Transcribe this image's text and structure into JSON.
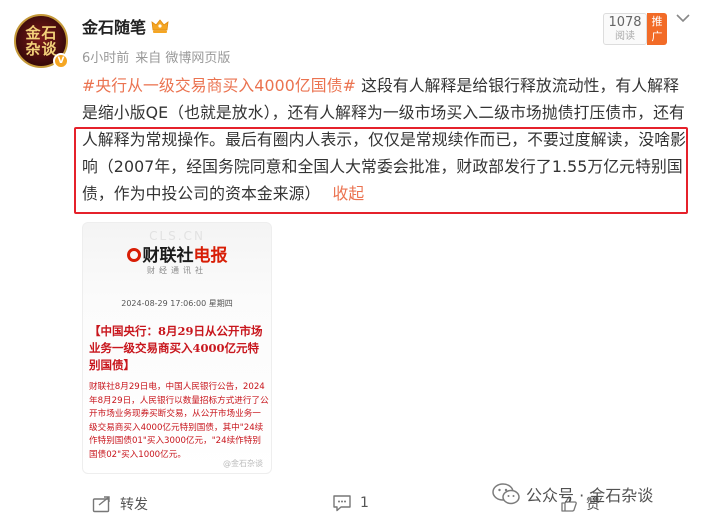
{
  "author": {
    "name": "金石随笔",
    "avatar_chars": [
      "金",
      "石",
      "杂",
      "谈"
    ]
  },
  "meta": {
    "time": "6小时前",
    "source": "来自 微博网页版"
  },
  "read": {
    "count": "1078",
    "label": "阅读",
    "promote": "推广"
  },
  "post": {
    "topic": "#央行从一级交易商买入4000亿国债#",
    "body": "这段有人解释是给银行释放流动性，有人解释是缩小版QE（也就是放水），还有人解释为一级市场买入二级市场抛债打压债市，还有人解释为常规操作。最后有圈内人表示，仅仅是常规续作而已，不要过度解读，没啥影响（2007年，经国务院同意和全国人大常委会批准，财政部发行了1.55万亿元特别国债，作为中投公司的资本金来源）",
    "collapse": "收起"
  },
  "card": {
    "watermark": "CLS.CN",
    "logo_prefix": "财联社",
    "logo_suffix": "电报",
    "subtitle": "财经通讯社",
    "date": "2024-08-29 17:06:00 星期四",
    "headline": "【中国央行：8月29日从公开市场业务一级交易商买入4000亿元特别国债】",
    "body": "财联社8月29日电，中国人民银行公告，2024年8月29日，人民银行以数量招标方式进行了公开市场业务现券买断交易，从公开市场业务一级交易商买入4000亿元特别国债，其中\"24续作特别国债01\"买入3000亿元，\"24续作特别国债02\"买入1000亿元。",
    "footer": "@金石杂谈"
  },
  "actions": {
    "forward": "转发",
    "comment_count": "1",
    "like": "赞"
  },
  "watermark": {
    "text": "公众号 · 金石杂谈"
  },
  "colors": {
    "topic": "#eb7350",
    "highlight_border": "#e5212b",
    "promote_bg": "#f26b27",
    "card_red": "#c8161d"
  }
}
